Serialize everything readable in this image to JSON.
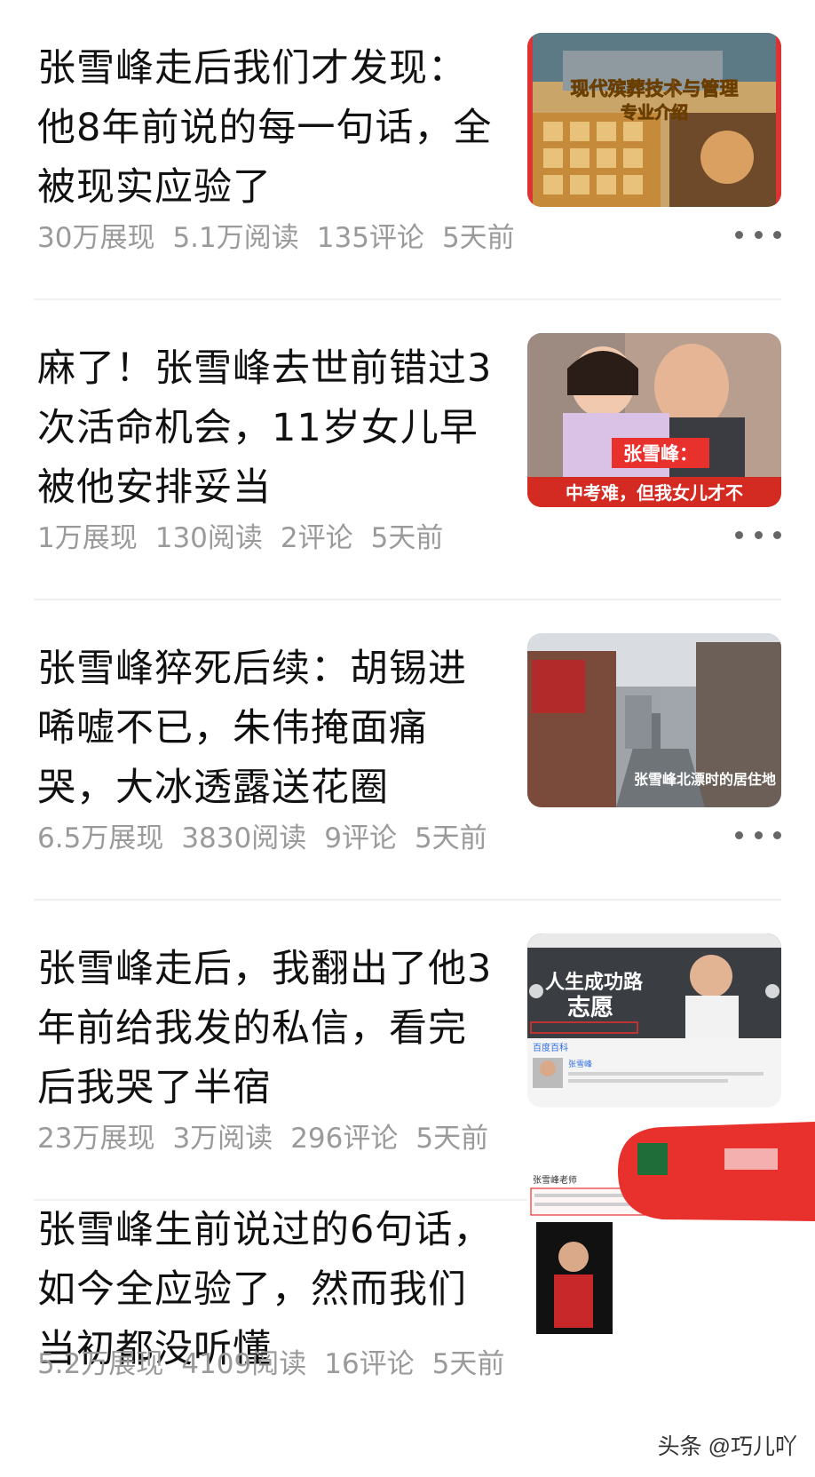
{
  "articles": [
    {
      "title": "张雪峰走后我们才发现：他8年前说的每一句话，全被现实应验了",
      "views": "30万展现",
      "reads": "5.1万阅读",
      "comments": "135评论",
      "time": "5天前",
      "thumb_text": [
        "现代殡葬技术与管理",
        "专业介绍"
      ]
    },
    {
      "title": "麻了！张雪峰去世前错过3次活命机会，11岁女儿早被他安排妥当",
      "views": "1万展现",
      "reads": "130阅读",
      "comments": "2评论",
      "time": "5天前",
      "thumb_text": [
        "张雪峰：",
        "中考难，但我女儿才不"
      ]
    },
    {
      "title": "张雪峰猝死后续：胡锡进唏嘘不已，朱伟掩面痛哭，大冰透露送花圈",
      "views": "6.5万展现",
      "reads": "3830阅读",
      "comments": "9评论",
      "time": "5天前",
      "thumb_text": [
        "张雪峰北漂时的居住地"
      ]
    },
    {
      "title": "张雪峰走后，我翻出了他3年前给我发的私信，看完后我哭了半宿",
      "views": "23万展现",
      "reads": "3万阅读",
      "comments": "296评论",
      "time": "5天前",
      "thumb_text": [
        "人生成功路",
        "志愿",
        "百度百科",
        "张雪峰"
      ]
    },
    {
      "title": "张雪峰生前说过的6句话，如今全应验了，然而我们当初都没听懂",
      "views": "5.2万展现",
      "reads": "4109阅读",
      "comments": "16评论",
      "time": "5天前",
      "thumb_text": [
        "张雪峰老师"
      ]
    }
  ],
  "watermark": "头条 @巧儿吖",
  "icons": {
    "more": "more-dots-icon"
  },
  "colors": {
    "meta": "#9a9a9a",
    "title": "#111111",
    "accent_red": "#e8302d"
  }
}
